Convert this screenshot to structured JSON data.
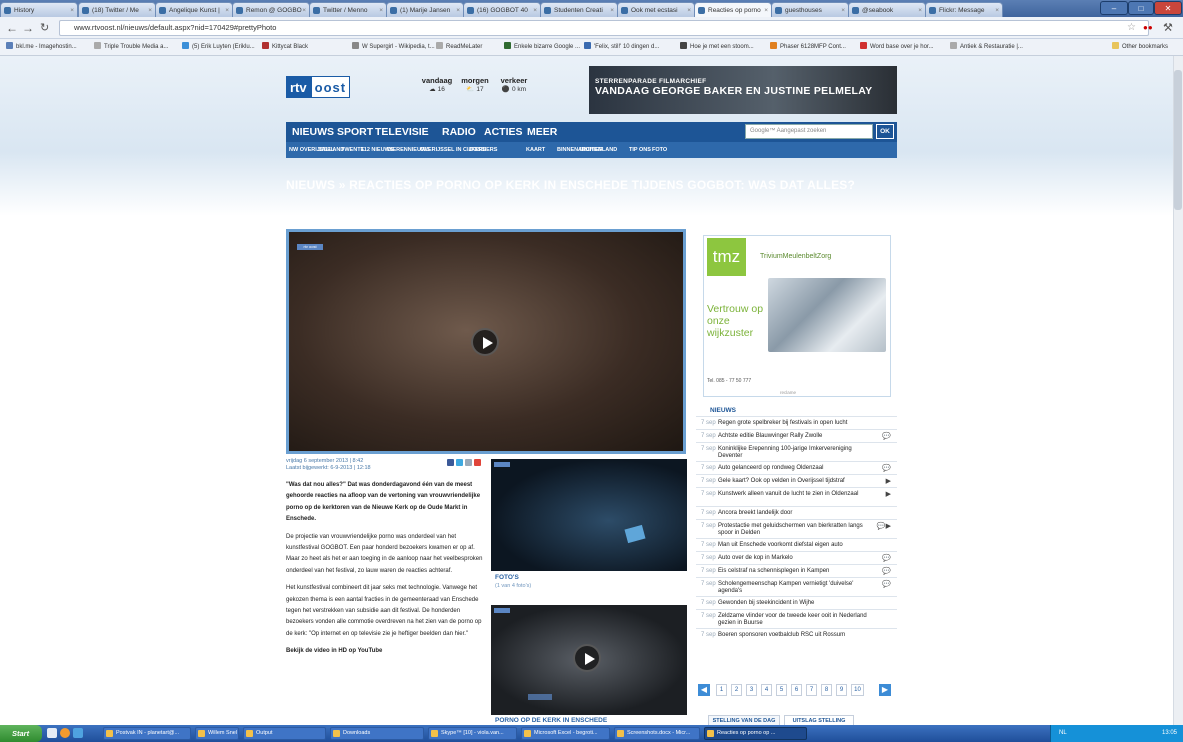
{
  "browser": {
    "tabs": [
      {
        "label": "History"
      },
      {
        "label": "(18) Twitter / Me"
      },
      {
        "label": "Angelique Kunst |"
      },
      {
        "label": "Remon @ GOGBO"
      },
      {
        "label": "Twitter / Menno"
      },
      {
        "label": "(1) Marije Jansen"
      },
      {
        "label": "(16) GOGBOT 40"
      },
      {
        "label": "Studenten Creati"
      },
      {
        "label": "Ook met ecstasi"
      },
      {
        "label": "Reacties op porno"
      },
      {
        "label": "guesthouses"
      },
      {
        "label": "@seabook"
      },
      {
        "label": "Flickr: Message"
      }
    ],
    "url": "www.rtvoost.nl/nieuws/default.aspx?nid=170429#prettyPhoto",
    "bookmarks": [
      {
        "label": "bkl.me - Imagehostin...",
        "color": "#5a7fb8"
      },
      {
        "label": "Triple Trouble Media a...",
        "color": "#aaaaaa"
      },
      {
        "label": "(5) Erik Luyten (Eriklu...",
        "color": "#3b8fd8"
      },
      {
        "label": "Kittycat Black",
        "color": "#b03030"
      },
      {
        "label": "W Supergirl - Wikipedia, t...",
        "color": "#888888"
      },
      {
        "label": "ReadMeLater",
        "color": "#aaaaaa"
      },
      {
        "label": "Enkele bizarre Google ...",
        "color": "#2f6a30"
      },
      {
        "label": "'Felix, stil!' 10 dingen d...",
        "color": "#3a6ab0"
      },
      {
        "label": "Hoe je met een stoom...",
        "color": "#444444"
      },
      {
        "label": "Phaser 6128MFP Cont...",
        "color": "#e08020"
      },
      {
        "label": "Word base over je hor...",
        "color": "#d03030"
      },
      {
        "label": "Antiek & Restauratie |...",
        "color": "#aaaaaa"
      }
    ],
    "other_bookmarks": "Other bookmarks"
  },
  "site": {
    "logo_left": "rtv",
    "logo_right": "oost",
    "weather": [
      {
        "day": "vandaag",
        "value": "16"
      },
      {
        "day": "morgen",
        "value": "17"
      },
      {
        "day": "verkeer",
        "value": "0 km"
      }
    ],
    "banner_small": "STERRENPARADE FILMARCHIEF",
    "banner_large": "VANDAAG GEORGE BAKER EN JUSTINE PELMELAY",
    "nav": [
      "NIEUWS",
      "SPORT",
      "TELEVISIE",
      "RADIO",
      "ACTIES",
      "MEER"
    ],
    "search_placeholder": "Google™ Aangepast zoeken",
    "search_button": "OK",
    "subnav": [
      "NW OVERIJSSEL",
      "SALLAND",
      "TWENTE",
      "112 NIEUWS",
      "DIERENNIEUWS",
      "OVERIJSSEL IN CIJFERS",
      "DOSSIERS",
      "KAART",
      "BINNEN-/BUITENLAND",
      "ARCHIEF",
      "TIP ONS",
      "FOTO"
    ],
    "page_title": "NIEUWS » REACTIES OP PORNO OP KERK IN ENSCHEDE TIJDENS GOGBOT: WAS DAT ALLES?"
  },
  "article": {
    "date": "vrijdag 6 september 2013 | 8:42",
    "updated": "Laatst bijgewerkt: 6-9-2013 | 12:18",
    "lead": "\"Was dat nou alles?\" Dat was donderdagavond één van de meest gehoorde reacties na afloop van de vertoning van vrouwvriendelijke porno op de kerktoren van de Nieuwe Kerk op de Oude Markt in Enschede.",
    "p1": "De projectie van vrouwvriendelijke porno was onderdeel van het kunstfestival GOGBOT. Een paar honderd bezoekers kwamen er op af. Maar zo heet als het er aan toeging in de aanloop naar het veelbesproken onderdeel van het festival, zo lauw waren de reacties achteraf.",
    "p2": "Het kunstfestival combineert dit jaar seks met technologie. Vanwege het gekozen thema is een aantal fracties in de gemeenteraad van Enschede tegen het verstrekken van subsidie aan dit festival. De honderden bezoekers vonden alle commotie overdreven na het zien van de porno op de kerk: \"Op internet en op televisie zie je heftiger beelden dan hier.\"",
    "p3": "Bekijk de video in HD op YouTube"
  },
  "thumbs": {
    "photos_caption": "FOTO'S",
    "photos_sub": "(1 van 4 foto's)",
    "video_caption": "PORNO OP DE KERK IN ENSCHEDE"
  },
  "ad": {
    "logo_text": "tmz",
    "brand": "TriviumMeulenbeltZorg",
    "slogan": "Vertrouw op onze wijkzuster",
    "phone": "Tel. 085 - 77 50 777",
    "footer": "reclame"
  },
  "news": {
    "header": "NIEUWS",
    "items": [
      {
        "date": "7 sep",
        "title": "Regen grote spelbreker bij festivals in open lucht",
        "icon": ""
      },
      {
        "date": "7 sep",
        "title": "Achtste editie Blauwvinger Rally Zwolle",
        "icon": "💬"
      },
      {
        "date": "7 sep",
        "title": "Koninklijke Erepenning 100-jarige Imkervereniging Deventer",
        "icon": ""
      },
      {
        "date": "7 sep",
        "title": "Auto gelanceerd op rondweg Oldenzaal",
        "icon": "💬"
      },
      {
        "date": "7 sep",
        "title": "Gele kaart? Ook op velden in Overijssel tijdstraf",
        "icon": "▶"
      },
      {
        "date": "7 sep",
        "title": "Kunstwerk alleen vanuit de lucht te zien in Oldenzaal",
        "icon": "▶"
      },
      {
        "date": "7 sep",
        "title": "Ancora breekt landelijk door",
        "icon": ""
      },
      {
        "date": "7 sep",
        "title": "Protestactie met geluidschermen van bierkratten langs spoor in Delden",
        "icon": "💬▶"
      },
      {
        "date": "7 sep",
        "title": "Man uit Enschede voorkomt diefstal eigen auto",
        "icon": ""
      },
      {
        "date": "7 sep",
        "title": "Auto over de kop in Markelo",
        "icon": "💬"
      },
      {
        "date": "7 sep",
        "title": "Eis celstraf na schennisplegen in Kampen",
        "icon": "💬"
      },
      {
        "date": "7 sep",
        "title": "Scholengemeenschap Kampen vernietigt 'duivelse' agenda's",
        "icon": "💬"
      },
      {
        "date": "7 sep",
        "title": "Gewonden bij steekincident in Wijhe",
        "icon": ""
      },
      {
        "date": "7 sep",
        "title": "Zeldzame vlinder voor de tweede keer ooit in Nederland gezien in Buurse",
        "icon": ""
      },
      {
        "date": "7 sep",
        "title": "Boeren sponsoren voetbalclub RSC uit Rossum",
        "icon": ""
      }
    ],
    "pages": [
      "1",
      "2",
      "3",
      "4",
      "5",
      "6",
      "7",
      "8",
      "9",
      "10"
    ],
    "tabs": [
      "STELLING VAN DE DAG",
      "UITSLAG STELLING"
    ]
  },
  "taskbar": {
    "start": "Start",
    "items": [
      {
        "label": "Postvak IN - planetart@..."
      },
      {
        "label": "Willem Snel"
      },
      {
        "label": "Output"
      },
      {
        "label": "Downloads"
      },
      {
        "label": "Skype™ [10] - viola.van..."
      },
      {
        "label": "Microsoft Excel - begroti..."
      },
      {
        "label": "Screenshots.docx - Micr..."
      },
      {
        "label": "Reacties op porno op ..."
      }
    ],
    "tray": "NL",
    "clock": "13:05"
  }
}
